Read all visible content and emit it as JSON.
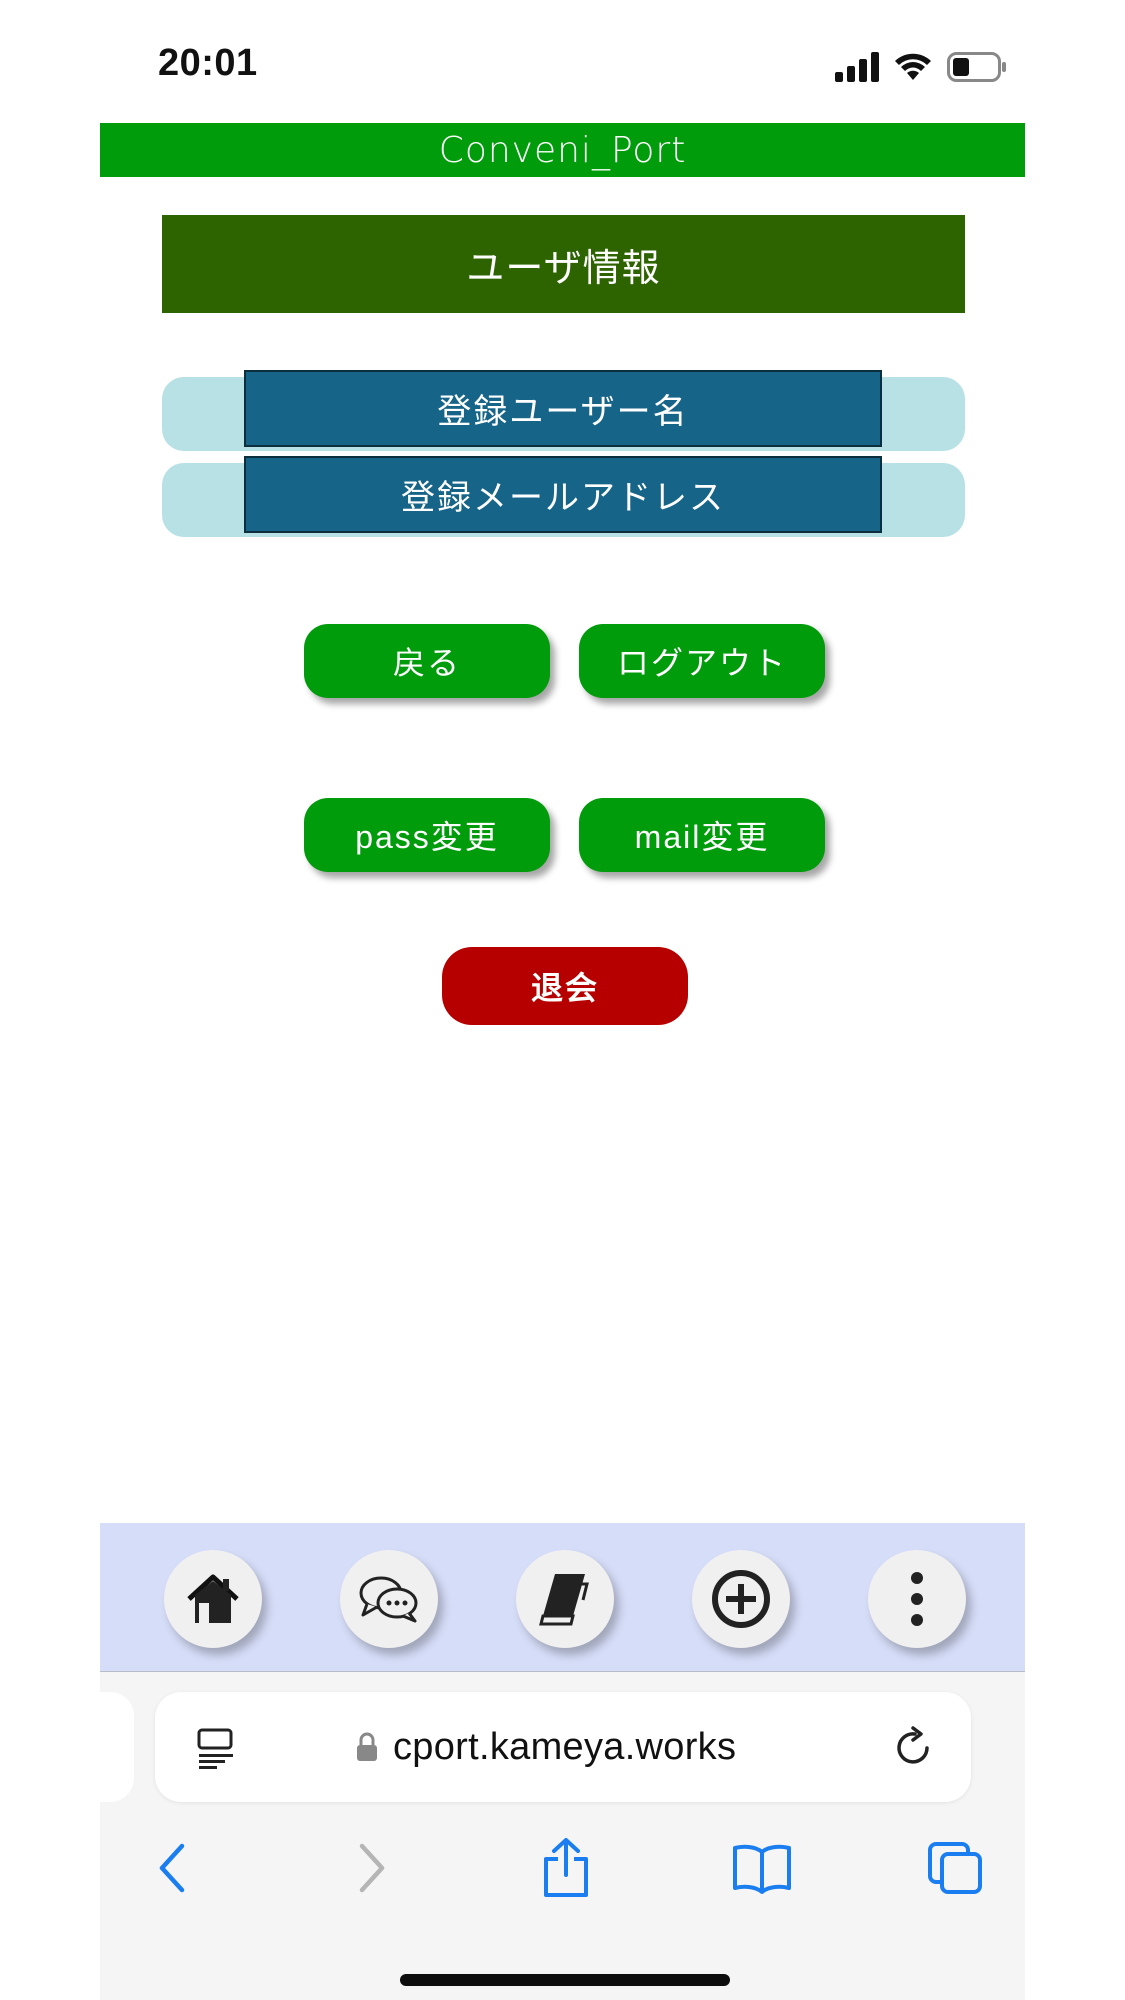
{
  "status_bar": {
    "time": "20:01",
    "icons": [
      "signal-icon",
      "wifi-icon",
      "battery-icon"
    ]
  },
  "app": {
    "title": "Conveni_Port",
    "header_color": "#019c0b"
  },
  "section": {
    "title": "ユーザ情報"
  },
  "info": {
    "username_label": "登録ユーザー名",
    "email_label": "登録メールアドレス"
  },
  "buttons": {
    "back": "戻る",
    "logout": "ログアウト",
    "change_pass": "pass変更",
    "change_mail": "mail変更",
    "withdraw": "退会"
  },
  "colors": {
    "primary_green": "#019c0b",
    "dark_green": "#2d6400",
    "info_blue": "#166488",
    "info_bg": "#b7e1e5",
    "danger": "#b60000",
    "bottom_bar": "#d6ddf8"
  },
  "bottom_nav": {
    "items": [
      "home-icon",
      "chat-icon",
      "book-icon",
      "plus-circle-icon",
      "more-vertical-icon"
    ]
  },
  "browser": {
    "url": "cport.kameya.works",
    "toolbar": [
      "back-icon",
      "forward-icon",
      "share-icon",
      "bookmarks-icon",
      "tabs-icon"
    ]
  }
}
